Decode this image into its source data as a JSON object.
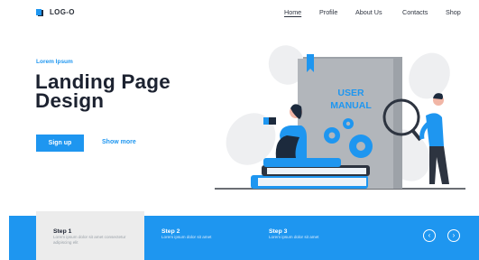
{
  "header": {
    "logo_text": "LOG-O",
    "nav": [
      {
        "label": "Home",
        "active": true
      },
      {
        "label": "Profile",
        "active": false
      },
      {
        "label": "About Us",
        "active": false
      },
      {
        "label": "Contacts",
        "active": false
      },
      {
        "label": "Shop",
        "active": false
      }
    ]
  },
  "hero": {
    "eyebrow": "Lorem Ipsum",
    "title_line1": "Landing Page",
    "title_line2": "Design",
    "signup_label": "Sign up",
    "more_label": "Show more",
    "book_title_line1": "USER",
    "book_title_line2": "MANUAL"
  },
  "steps": [
    {
      "title": "Step 1",
      "text": "Lorem ipsum dolor sit amet consectetur adipiscing elit",
      "active": true
    },
    {
      "title": "Step 2",
      "text": "Lorem ipsum dolor sit amet",
      "active": false
    },
    {
      "title": "Step 3",
      "text": "Lorem ipsum dolor sit amet",
      "active": false
    }
  ],
  "carousel": {
    "prev_icon": "chevron-left-icon",
    "next_icon": "chevron-right-icon"
  },
  "colors": {
    "accent": "#1e96f0",
    "dark": "#1c2230",
    "book": "#a9adb2"
  }
}
